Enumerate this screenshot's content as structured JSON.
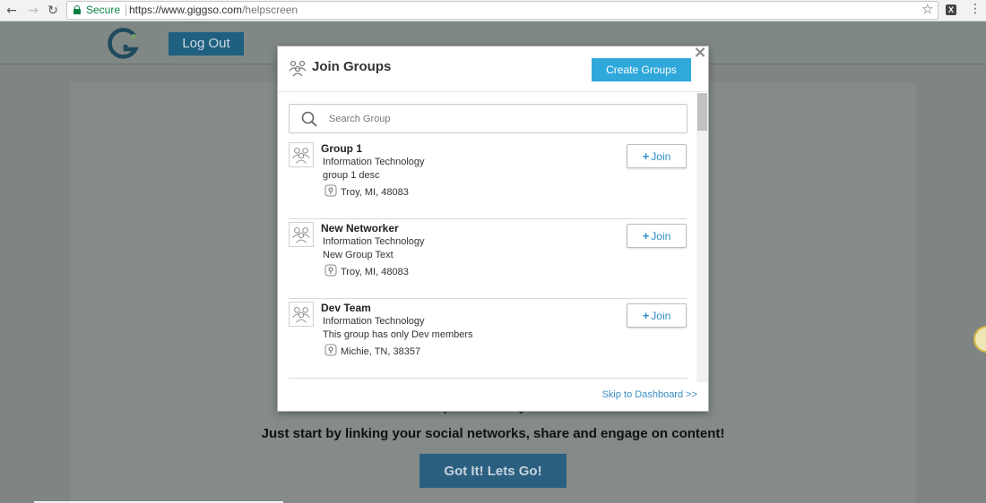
{
  "browser": {
    "secure_label": "Secure",
    "url_host": "https://www.giggso.com",
    "url_path": "/helpscreen",
    "ext_label": "X"
  },
  "site": {
    "logout_label": "Log Out",
    "tagline_hidden": "No simple to build your score",
    "tagline": "Just start by linking your social networks, share and engage on content!",
    "gotit_label": "Got It! Lets Go!"
  },
  "modal": {
    "title": "Join Groups",
    "create_label": "Create Groups",
    "close_label": "×",
    "search": {
      "placeholder": "Search Group"
    },
    "join_label": "Join",
    "groups": [
      {
        "name": "Group 1",
        "category": "Information Technology",
        "description": "group 1 desc",
        "location": "Troy, MI, 48083"
      },
      {
        "name": "New Networker",
        "category": "Information Technology",
        "description": "New Group Text",
        "location": "Troy, MI, 48083"
      },
      {
        "name": "Dev Team",
        "category": "Information Technology",
        "description": "This group has only Dev members",
        "location": "Michie, TN, 38357"
      }
    ],
    "skip_label": "Skip to Dashboard >>"
  },
  "colors": {
    "accent": "#2fa8db",
    "link": "#3a8fc2",
    "overlay": "#7f8583",
    "secure": "#0b8043"
  }
}
